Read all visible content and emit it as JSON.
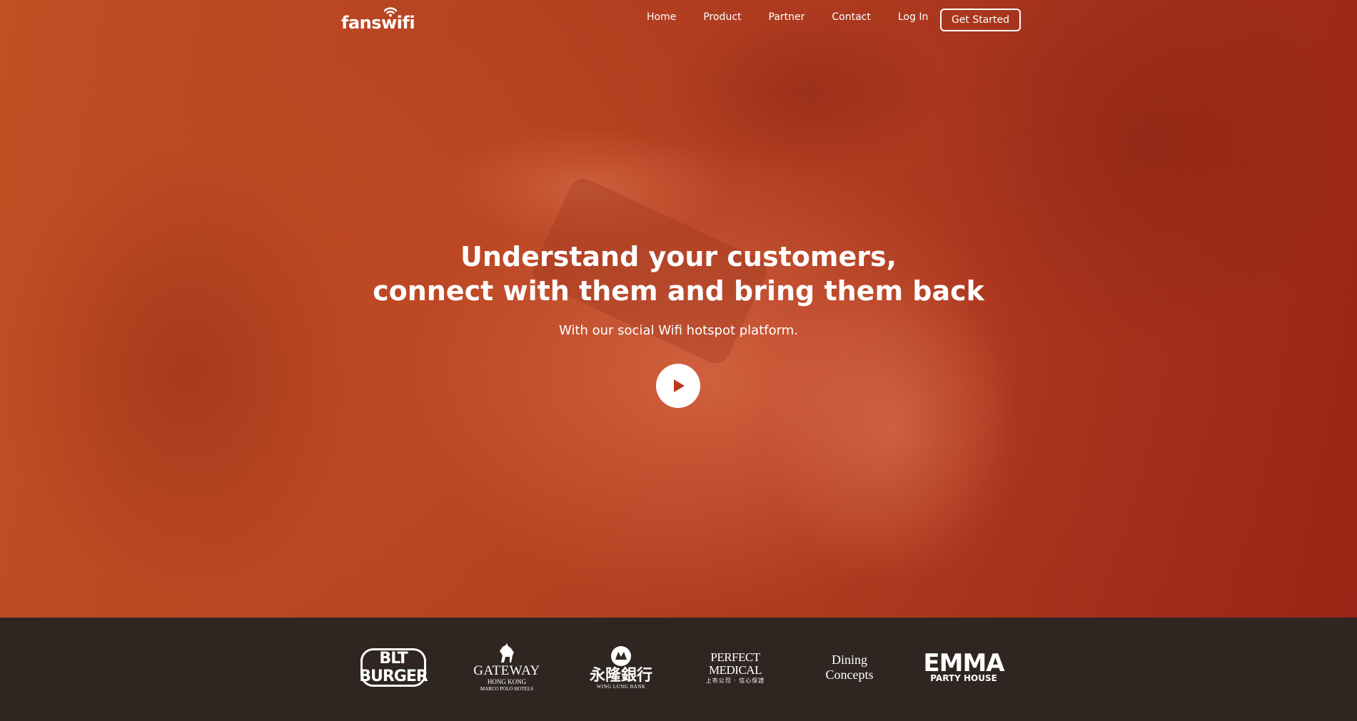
{
  "brand": {
    "logo_text": "fanswifi"
  },
  "nav": {
    "items": [
      {
        "label": "Home"
      },
      {
        "label": "Product"
      },
      {
        "label": "Partner"
      },
      {
        "label": "Contact"
      },
      {
        "label": "Log In"
      }
    ],
    "cta_label": "Get Started"
  },
  "hero": {
    "headline_line1": "Understand your customers,",
    "headline_line2": "connect with them and bring them back",
    "subheadline": "With our social Wifi hotspot platform.",
    "play_icon": "play-icon"
  },
  "partners": {
    "blt": {
      "text": "BLT BURGER"
    },
    "gateway": {
      "name": "GATEWAY",
      "sub": "HONG KONG",
      "sub2": "MARCO POLO HOTELS"
    },
    "winglung": {
      "cn": "永隆銀行",
      "en": "WING LUNG BANK"
    },
    "perfect_medical": {
      "name": "PERFECT MEDICAL",
      "sub": "上市公司 · 信心保證"
    },
    "dining_concepts": {
      "name": "Dining Concepts"
    },
    "emma": {
      "name": "EMMA",
      "sub": "PARTY HOUSE"
    }
  },
  "colors": {
    "hero_orange": "#cf5828",
    "hero_red": "#a02818",
    "footer_bg": "#2f2622",
    "text": "#ffffff"
  }
}
